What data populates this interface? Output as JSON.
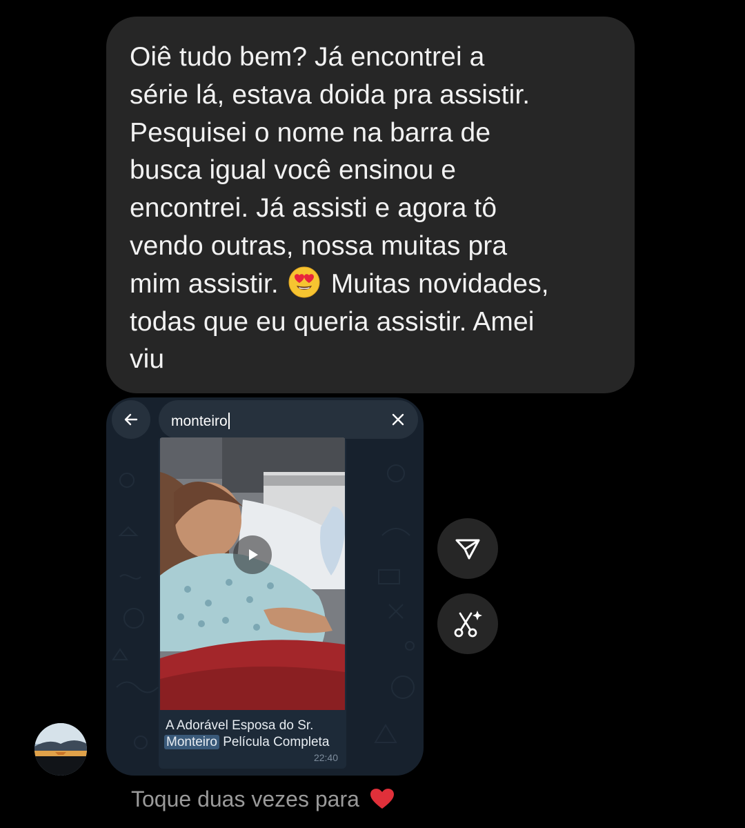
{
  "message": {
    "lines": [
      "Oiê tudo bem? Já encontrei a",
      "série lá, estava doida pra assistir.",
      "Pesquisei o nome na barra de",
      "busca igual você ensinou e",
      "encontrei. Já assisti e agora tô",
      "vendo outras, nossa muitas pra"
    ],
    "line7_before": "mim assistir.",
    "line7_emoji": "smiling-face-with-heart-eyes",
    "line7_after": "Muitas novidades,",
    "line8": "todas que eu queria assistir. Amei",
    "line9": "viu"
  },
  "screenshot": {
    "search_query": "monteiro",
    "back_icon": "arrow-left-icon",
    "clear_icon": "close-icon",
    "caption_title": "A Adorável Esposa do Sr.",
    "caption_highlight": "Monteiro",
    "caption_rest": "Película Completa",
    "time": "22:40"
  },
  "actions": {
    "share_icon": "paper-plane-icon",
    "ai_icon": "scissors-sparkle-icon"
  },
  "footer": {
    "hint": "Toque duas vezes para",
    "heart_icon": "red-heart-icon",
    "heart_color": "#e0303a"
  }
}
